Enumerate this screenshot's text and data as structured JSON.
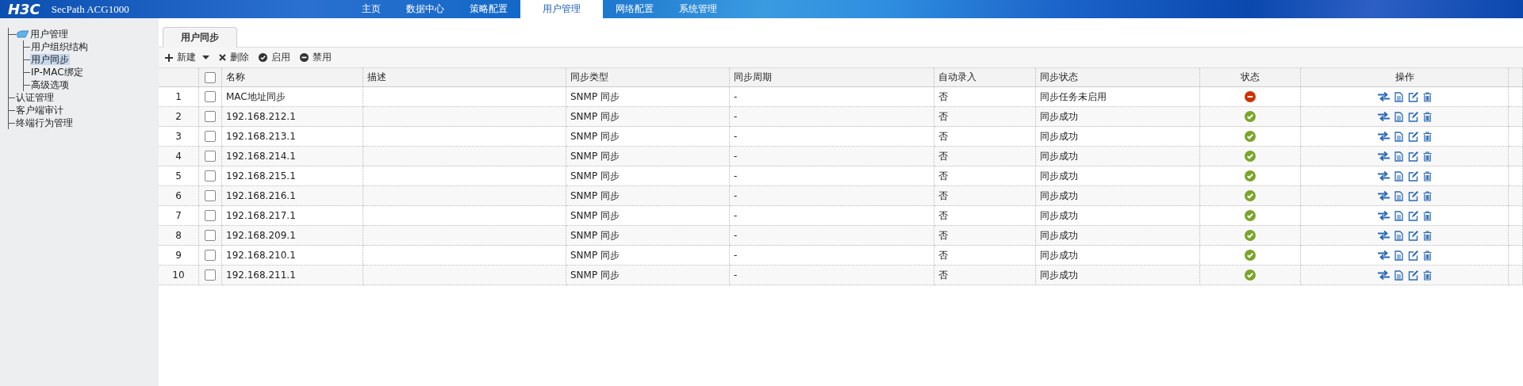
{
  "header": {
    "logo": "H3C",
    "product": "SecPath ACG1000",
    "nav": [
      {
        "label": "主页",
        "selected": false
      },
      {
        "label": "数据中心",
        "selected": false
      },
      {
        "label": "策略配置",
        "selected": false
      },
      {
        "label": "用户管理",
        "selected": true
      },
      {
        "label": "网络配置",
        "selected": false
      },
      {
        "label": "系统管理",
        "selected": false
      }
    ]
  },
  "sidebar": {
    "tree": [
      {
        "label": "用户管理",
        "selected": false,
        "children": [
          {
            "label": "用户组织结构",
            "selected": false
          },
          {
            "label": "用户同步",
            "selected": true
          },
          {
            "label": "IP-MAC绑定",
            "selected": false
          },
          {
            "label": "高级选项",
            "selected": false
          }
        ]
      },
      {
        "label": "认证管理",
        "selected": false
      },
      {
        "label": "客户端审计",
        "selected": false
      },
      {
        "label": "终端行为管理",
        "selected": false
      }
    ]
  },
  "tabs": [
    {
      "label": "用户同步",
      "selected": true
    }
  ],
  "toolbar": [
    {
      "kind": "add",
      "label": "新建",
      "dropdown": true
    },
    {
      "kind": "delete",
      "label": "删除",
      "dropdown": false
    },
    {
      "kind": "enable",
      "label": "启用",
      "dropdown": false
    },
    {
      "kind": "disable",
      "label": "禁用",
      "dropdown": false
    }
  ],
  "table": {
    "select_all": {
      "checked": false
    },
    "columns": [
      "名称",
      "描述",
      "同步类型",
      "同步周期",
      "自动录入",
      "同步状态",
      "状态",
      "操作"
    ],
    "rows": [
      {
        "index": "1",
        "checked": false,
        "name": "MAC地址同步",
        "sync_type": "SNMP 同步",
        "sync_period": "-",
        "auto_import": "否",
        "sync_status": "同步任务未启用",
        "enabled": false
      },
      {
        "index": "2",
        "checked": false,
        "name": "192.168.212.1",
        "sync_type": "SNMP 同步",
        "sync_period": "-",
        "auto_import": "否",
        "sync_status": "同步成功",
        "enabled": true
      },
      {
        "index": "3",
        "checked": false,
        "name": "192.168.213.1",
        "sync_type": "SNMP 同步",
        "sync_period": "-",
        "auto_import": "否",
        "sync_status": "同步成功",
        "enabled": true
      },
      {
        "index": "4",
        "checked": false,
        "name": "192.168.214.1",
        "sync_type": "SNMP 同步",
        "sync_period": "-",
        "auto_import": "否",
        "sync_status": "同步成功",
        "enabled": true
      },
      {
        "index": "5",
        "checked": false,
        "name": "192.168.215.1",
        "sync_type": "SNMP 同步",
        "sync_period": "-",
        "auto_import": "否",
        "sync_status": "同步成功",
        "enabled": true
      },
      {
        "index": "6",
        "checked": false,
        "name": "192.168.216.1",
        "sync_type": "SNMP 同步",
        "sync_period": "-",
        "auto_import": "否",
        "sync_status": "同步成功",
        "enabled": true
      },
      {
        "index": "7",
        "checked": false,
        "name": "192.168.217.1",
        "sync_type": "SNMP 同步",
        "sync_period": "-",
        "auto_import": "否",
        "sync_status": "同步成功",
        "enabled": true
      },
      {
        "index": "8",
        "checked": false,
        "name": "192.168.209.1",
        "sync_type": "SNMP 同步",
        "sync_period": "-",
        "auto_import": "否",
        "sync_status": "同步成功",
        "enabled": true
      },
      {
        "index": "9",
        "checked": false,
        "name": "192.168.210.1",
        "sync_type": "SNMP 同步",
        "sync_period": "-",
        "auto_import": "否",
        "sync_status": "同步成功",
        "enabled": true
      },
      {
        "index": "10",
        "checked": false,
        "name": "192.168.211.1",
        "sync_type": "SNMP 同步",
        "sync_period": "-",
        "auto_import": "否",
        "sync_status": "同步成功",
        "enabled": true
      }
    ]
  }
}
